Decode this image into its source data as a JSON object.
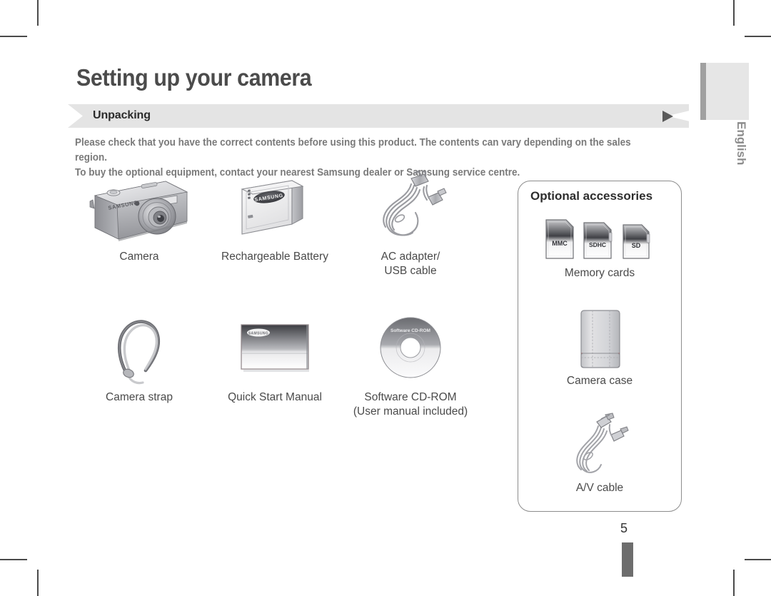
{
  "page": {
    "title": "Setting up your camera",
    "number": "5",
    "language_tab": "English"
  },
  "section": {
    "label": "Unpacking",
    "arrow_icon": "play-triangle-icon"
  },
  "intro": {
    "line1": "Please check that you have the correct contents before using this product. The contents can vary depending on the sales region.",
    "line2": "To buy the optional equipment, contact your nearest Samsung dealer or Samsung service centre."
  },
  "contents": {
    "rows": [
      [
        {
          "label": "Camera",
          "label2": "",
          "icon": "camera-icon",
          "brand": "SAMSUNG"
        },
        {
          "label": "Rechargeable Battery",
          "label2": "",
          "icon": "battery-icon",
          "brand": "SAMSUNG"
        },
        {
          "label": "AC adapter/",
          "label2": "USB cable",
          "icon": "ac-adapter-usb-cable-icon"
        }
      ],
      [
        {
          "label": "Camera strap",
          "label2": "",
          "icon": "camera-strap-icon"
        },
        {
          "label": "Quick Start Manual",
          "label2": "",
          "icon": "quick-start-manual-icon",
          "brand": "SAMSUNG"
        },
        {
          "label": "Software CD-ROM",
          "label2": "(User manual included)",
          "icon": "cd-rom-icon",
          "disc_text": "Software CD-ROM"
        }
      ]
    ]
  },
  "optional": {
    "title": "Optional accessories",
    "items": [
      {
        "label": "Memory cards",
        "icon": "memory-cards-icon",
        "cards": [
          "MMC",
          "SDHC",
          "SD"
        ]
      },
      {
        "label": "Camera case",
        "icon": "camera-case-icon"
      },
      {
        "label": "A/V cable",
        "icon": "av-cable-icon"
      }
    ]
  },
  "colors": {
    "section_bar": "#e4e4e4",
    "title_text": "#4b4b4b",
    "body_text": "#7a7a7a",
    "label_text": "#4a4a4a",
    "panel_border": "#8d8d8d",
    "tab_gray": "#e6e6e6",
    "marker_gray": "#6d6d6d"
  }
}
